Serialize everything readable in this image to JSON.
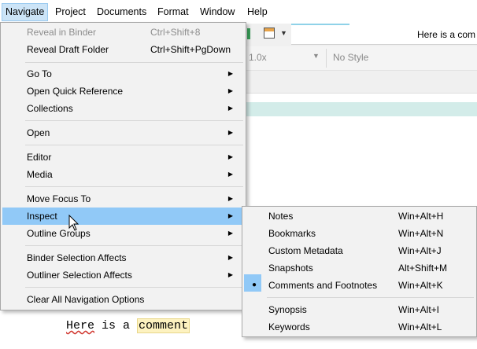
{
  "menubar": {
    "items": [
      "Navigate",
      "Project",
      "Documents",
      "Format",
      "Window",
      "Help"
    ]
  },
  "background": {
    "title_text": "Here is a com",
    "zoom": "1.0x",
    "style": "No Style",
    "comment_line": {
      "word1": "Here",
      "rest": " is a ",
      "highlighted": "comment"
    }
  },
  "navigate_menu": {
    "items": [
      {
        "label": "Reveal in Binder",
        "shortcut": "Ctrl+Shift+8",
        "disabled": true
      },
      {
        "label": "Reveal Draft Folder",
        "shortcut": "Ctrl+Shift+PgDown"
      },
      {
        "label": "Go To",
        "submenu": true
      },
      {
        "label": "Open Quick Reference",
        "submenu": true
      },
      {
        "label": "Collections",
        "submenu": true
      },
      {
        "label": "Open",
        "submenu": true
      },
      {
        "label": "Editor",
        "submenu": true
      },
      {
        "label": "Media",
        "submenu": true
      },
      {
        "label": "Move Focus To",
        "submenu": true
      },
      {
        "label": "Inspect",
        "submenu": true,
        "highlighted": true
      },
      {
        "label": "Outline Groups",
        "submenu": true
      },
      {
        "label": "Binder Selection Affects",
        "submenu": true
      },
      {
        "label": "Outliner Selection Affects",
        "submenu": true
      },
      {
        "label": "Clear All Navigation Options"
      }
    ]
  },
  "inspect_submenu": {
    "items": [
      {
        "label": "Notes",
        "shortcut": "Win+Alt+H"
      },
      {
        "label": "Bookmarks",
        "shortcut": "Win+Alt+N"
      },
      {
        "label": "Custom Metadata",
        "shortcut": "Win+Alt+J"
      },
      {
        "label": "Snapshots",
        "shortcut": "Alt+Shift+M"
      },
      {
        "label": "Comments and Footnotes",
        "shortcut": "Win+Alt+K",
        "checked": true
      },
      {
        "label": "Synopsis",
        "shortcut": "Win+Alt+I"
      },
      {
        "label": "Keywords",
        "shortcut": "Win+Alt+L"
      }
    ]
  },
  "icons": {
    "submenu_arrow": "triangle-right-icon",
    "checked_marker": "bullet-icon",
    "pointer": "mouse-cursor-icon"
  },
  "colors": {
    "menu_highlight": "#91c9f7",
    "menubar_active": "#cce4f7",
    "menu_background": "#f2f2f2"
  }
}
